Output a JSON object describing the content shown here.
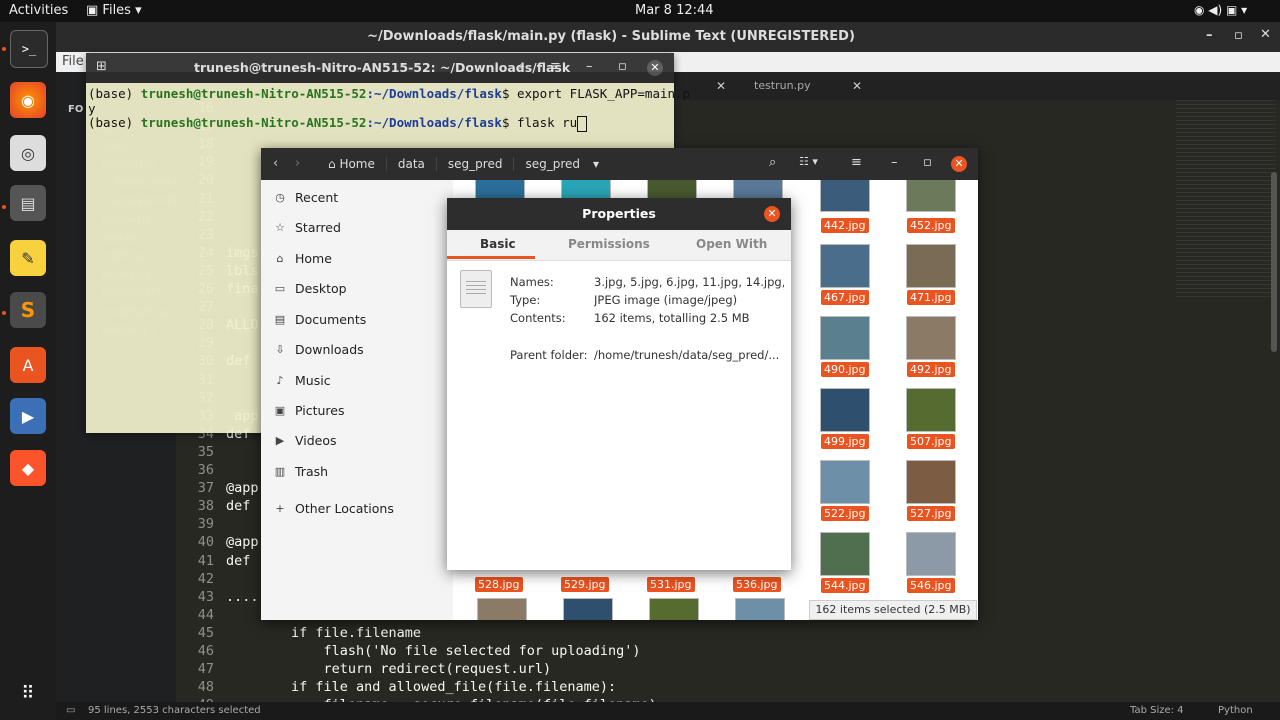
{
  "topbar": {
    "activities": "Activities",
    "app": "Files",
    "clock": "Mar 8  12:44"
  },
  "sublime": {
    "title": "~/Downloads/flask/main.py (flask) - Sublime Text (UNREGISTERED)",
    "menu_file": "File",
    "side_label": "FO",
    "folders": [
      "flask",
      "data",
      "templates",
      "display.html",
      "upload.html",
      "UPLOADS",
      "app.py",
      "main.py",
      "main2.py",
      "model.hdf5",
      "mytempe.py",
      "testrun.py"
    ],
    "tabs": [
      "testrun.py"
    ],
    "lines": [
      {
        "n": "16",
        "t": ""
      },
      {
        "n": "17",
        "t": ""
      },
      {
        "n": "18",
        "t": ""
      },
      {
        "n": "19",
        "t": ""
      },
      {
        "n": "20",
        "t": ""
      },
      {
        "n": "21",
        "t": ""
      },
      {
        "n": "22",
        "t": ""
      },
      {
        "n": "23",
        "t": ""
      },
      {
        "n": "24",
        "t": "imgs"
      },
      {
        "n": "25",
        "t": "lbls"
      },
      {
        "n": "26",
        "t": "fina"
      },
      {
        "n": "27",
        "t": ""
      },
      {
        "n": "28",
        "t": "ALLO"
      },
      {
        "n": "29",
        "t": ""
      },
      {
        "n": "30",
        "t": "def"
      },
      {
        "n": "31",
        "t": ""
      },
      {
        "n": "32",
        "t": ""
      },
      {
        "n": "33",
        "t": " app"
      },
      {
        "n": "34",
        "t": "def"
      },
      {
        "n": "35",
        "t": ""
      },
      {
        "n": "36",
        "t": ""
      },
      {
        "n": "37",
        "t": "@app"
      },
      {
        "n": "38",
        "t": "def"
      },
      {
        "n": "39",
        "t": ""
      },
      {
        "n": "40",
        "t": "@app"
      },
      {
        "n": "41",
        "t": "def"
      },
      {
        "n": "42",
        "t": ""
      },
      {
        "n": "43",
        "t": "...."
      },
      {
        "n": "44",
        "t": ""
      },
      {
        "n": "45",
        "t": "        if file.filename"
      },
      {
        "n": "46",
        "t": "            flash('No file selected for uploading')"
      },
      {
        "n": "47",
        "t": "            return redirect(request.url)"
      },
      {
        "n": "48",
        "t": "        if file and allowed_file(file.filename):"
      },
      {
        "n": "49",
        "t": "            filename = secure_filename(file.filename)"
      }
    ],
    "status_left": "95 lines, 2553 characters selected",
    "tab_size": "Tab Size: 4",
    "syntax": "Python"
  },
  "terminal": {
    "title": "trunesh@trunesh-Nitro-AN515-52: ~/Downloads/flask",
    "lines": [
      {
        "prefix": "(base) ",
        "user": "trunesh@trunesh-Nitro-AN515-52",
        "path": ":~/Downloads/flask",
        "cmd": "$ export FLASK_APP=main.p"
      },
      {
        "prefix": "y",
        "user": "",
        "path": "",
        "cmd": ""
      },
      {
        "prefix": "(base) ",
        "user": "trunesh@trunesh-Nitro-AN515-52",
        "path": ":~/Downloads/flask",
        "cmd": "$ flask ru"
      }
    ]
  },
  "files": {
    "breadcrumbs": [
      "Home",
      "data",
      "seg_pred",
      "seg_pred"
    ],
    "sidebar": [
      "Recent",
      "Starred",
      "Home",
      "Desktop",
      "Documents",
      "Downloads",
      "Music",
      "Pictures",
      "Videos",
      "Trash",
      "Other Locations"
    ],
    "grid_right": [
      [
        "442.jpg",
        "452.jpg"
      ],
      [
        "467.jpg",
        "471.jpg"
      ],
      [
        "490.jpg",
        "492.jpg"
      ],
      [
        "499.jpg",
        "507.jpg"
      ],
      [
        "522.jpg",
        "527.jpg"
      ],
      [
        "544.jpg",
        "546.jpg"
      ]
    ],
    "bottom_row": [
      "528.jpg",
      "529.jpg",
      "531.jpg",
      "536.jpg"
    ],
    "selection_status": "162 items selected  (2.5 MB)"
  },
  "properties": {
    "title": "Properties",
    "tabs": [
      "Basic",
      "Permissions",
      "Open With"
    ],
    "rows": [
      {
        "label": "Names:",
        "value": "3.jpg, 5.jpg, 6.jpg, 11.jpg, 14.jpg,..."
      },
      {
        "label": "Type:",
        "value": "JPEG image (image/jpeg)"
      },
      {
        "label": "Contents:",
        "value": "162 items, totalling 2.5 MB"
      },
      {
        "label": "Parent folder:",
        "value": "/home/trunesh/data/seg_pred/..."
      }
    ]
  },
  "colors": {
    "accent": "#e95420",
    "terminal_bg": "#f1f1cd",
    "sublime_bg": "#272822"
  }
}
